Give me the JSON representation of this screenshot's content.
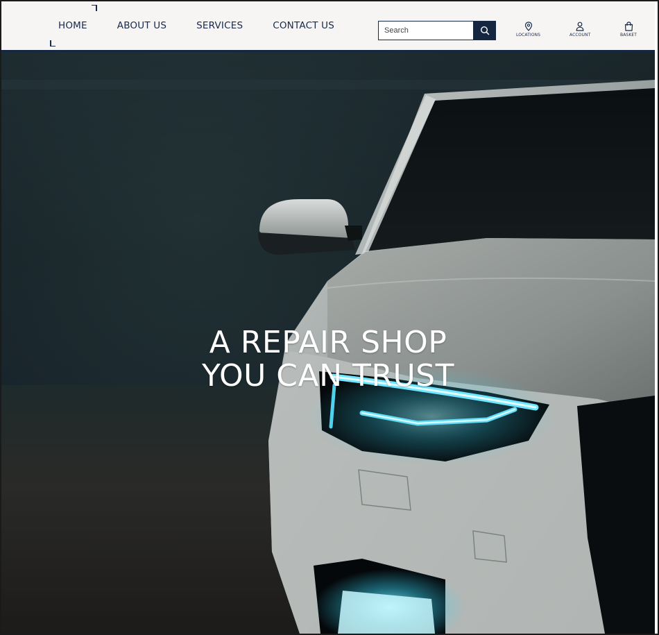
{
  "nav": {
    "items": [
      {
        "label": "HOME",
        "active": true
      },
      {
        "label": "ABOUT US",
        "active": false
      },
      {
        "label": "SERVICES",
        "active": false
      },
      {
        "label": "CONTACT US",
        "active": false
      }
    ]
  },
  "search": {
    "placeholder": "Search",
    "button_icon": "search-icon"
  },
  "utilities": {
    "locations": {
      "label": "LOCATIONS",
      "icon": "location-pin-icon"
    },
    "account": {
      "label": "ACCOUNT",
      "icon": "user-icon"
    },
    "basket": {
      "label": "BASKET",
      "icon": "shopping-bag-icon"
    }
  },
  "hero": {
    "title_line1": "A REPAIR SHOP",
    "title_line2": "YOU CAN TRUST",
    "image": "white-car-headlight-in-dark-garage"
  },
  "colors": {
    "header_bg": "#f7f4f4",
    "brand_navy": "#142640",
    "nav_text": "#15294a",
    "headlight": "#37d3f2",
    "hero_text": "#ffffff"
  }
}
